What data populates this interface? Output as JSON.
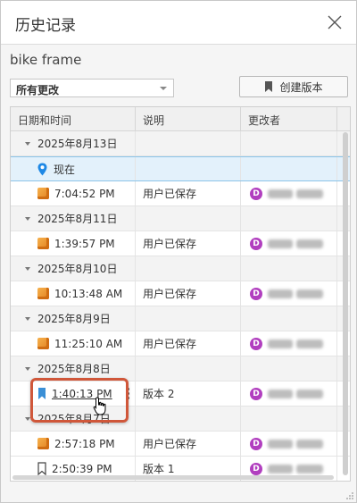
{
  "window": {
    "title": "历史记录"
  },
  "document": {
    "name": "bike frame"
  },
  "filter": {
    "selected": "所有更改"
  },
  "actions": {
    "create_version": "创建版本"
  },
  "table": {
    "headers": [
      "日期和时间",
      "说明",
      "更改者"
    ],
    "rows": [
      {
        "type": "group",
        "label": "2025年8月13日"
      },
      {
        "type": "current",
        "label": "现在"
      },
      {
        "type": "entry",
        "icon": "cube-icon",
        "time": "7:04:52 PM",
        "desc": "用户已保存",
        "user_initial": "D"
      },
      {
        "type": "group",
        "label": "2025年8月11日"
      },
      {
        "type": "entry",
        "icon": "cube-icon",
        "time": "1:39:57 PM",
        "desc": "用户已保存",
        "user_initial": "D"
      },
      {
        "type": "group",
        "label": "2025年8月10日"
      },
      {
        "type": "entry",
        "icon": "cube-icon",
        "time": "10:13:48 AM",
        "desc": "用户已保存",
        "user_initial": "D"
      },
      {
        "type": "group",
        "label": "2025年8月9日"
      },
      {
        "type": "entry",
        "icon": "cube-icon",
        "time": "11:25:10 AM",
        "desc": "用户已保存",
        "user_initial": "D"
      },
      {
        "type": "group",
        "label": "2025年8月8日"
      },
      {
        "type": "version",
        "icon": "bookmark-filled-icon",
        "time": "1:40:13 PM",
        "desc": "版本 2",
        "user_initial": "D"
      },
      {
        "type": "group",
        "label": "2025年8月7日"
      },
      {
        "type": "entry",
        "icon": "cube-icon",
        "time": "2:57:18 PM",
        "desc": "用户已保存",
        "user_initial": "D"
      },
      {
        "type": "version",
        "icon": "bookmark-outline-icon",
        "time": "2:50:39 PM",
        "desc": "版本 1",
        "user_initial": "D"
      }
    ]
  },
  "colors": {
    "selected_row": "#e3f1fb",
    "highlight": "#d0573a",
    "avatar": "#b13fbf",
    "location_pin": "#1e88e5"
  }
}
